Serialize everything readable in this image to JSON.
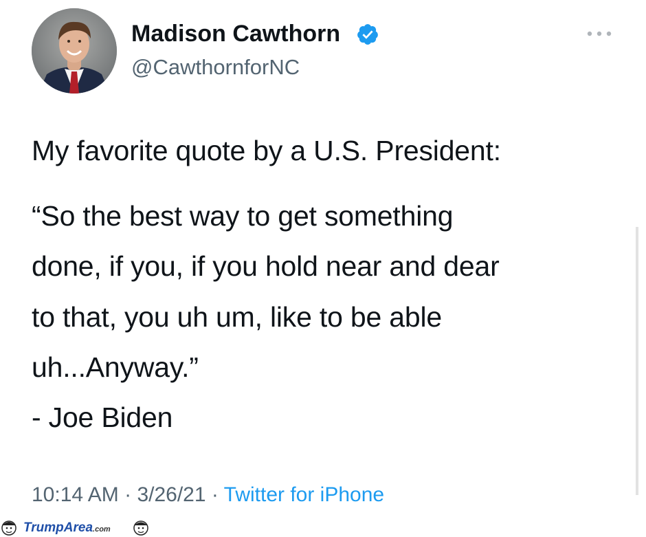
{
  "tweet": {
    "author": {
      "name": "Madison Cawthorn",
      "handle": "@CawthornforNC",
      "verified": true
    },
    "body_lines": [
      "My favorite quote by a U.S. President:",
      "“So the best way to get something",
      "done, if you, if you hold near and dear",
      "to that, you uh um, like to be able",
      "uh...Anyway.”",
      "- Joe Biden"
    ],
    "time": "10:14 AM",
    "separator": " · ",
    "date": "3/26/21",
    "source": "Twitter for iPhone"
  },
  "watermark": {
    "brand": "TrumpArea",
    "suffix": ".com"
  },
  "icons": {
    "verified": "verified-badge-icon",
    "more": "more-options-icon"
  },
  "colors": {
    "text": "#0f1419",
    "secondary": "#536471",
    "link": "#1d9bf0",
    "verified": "#1d9bf0"
  }
}
